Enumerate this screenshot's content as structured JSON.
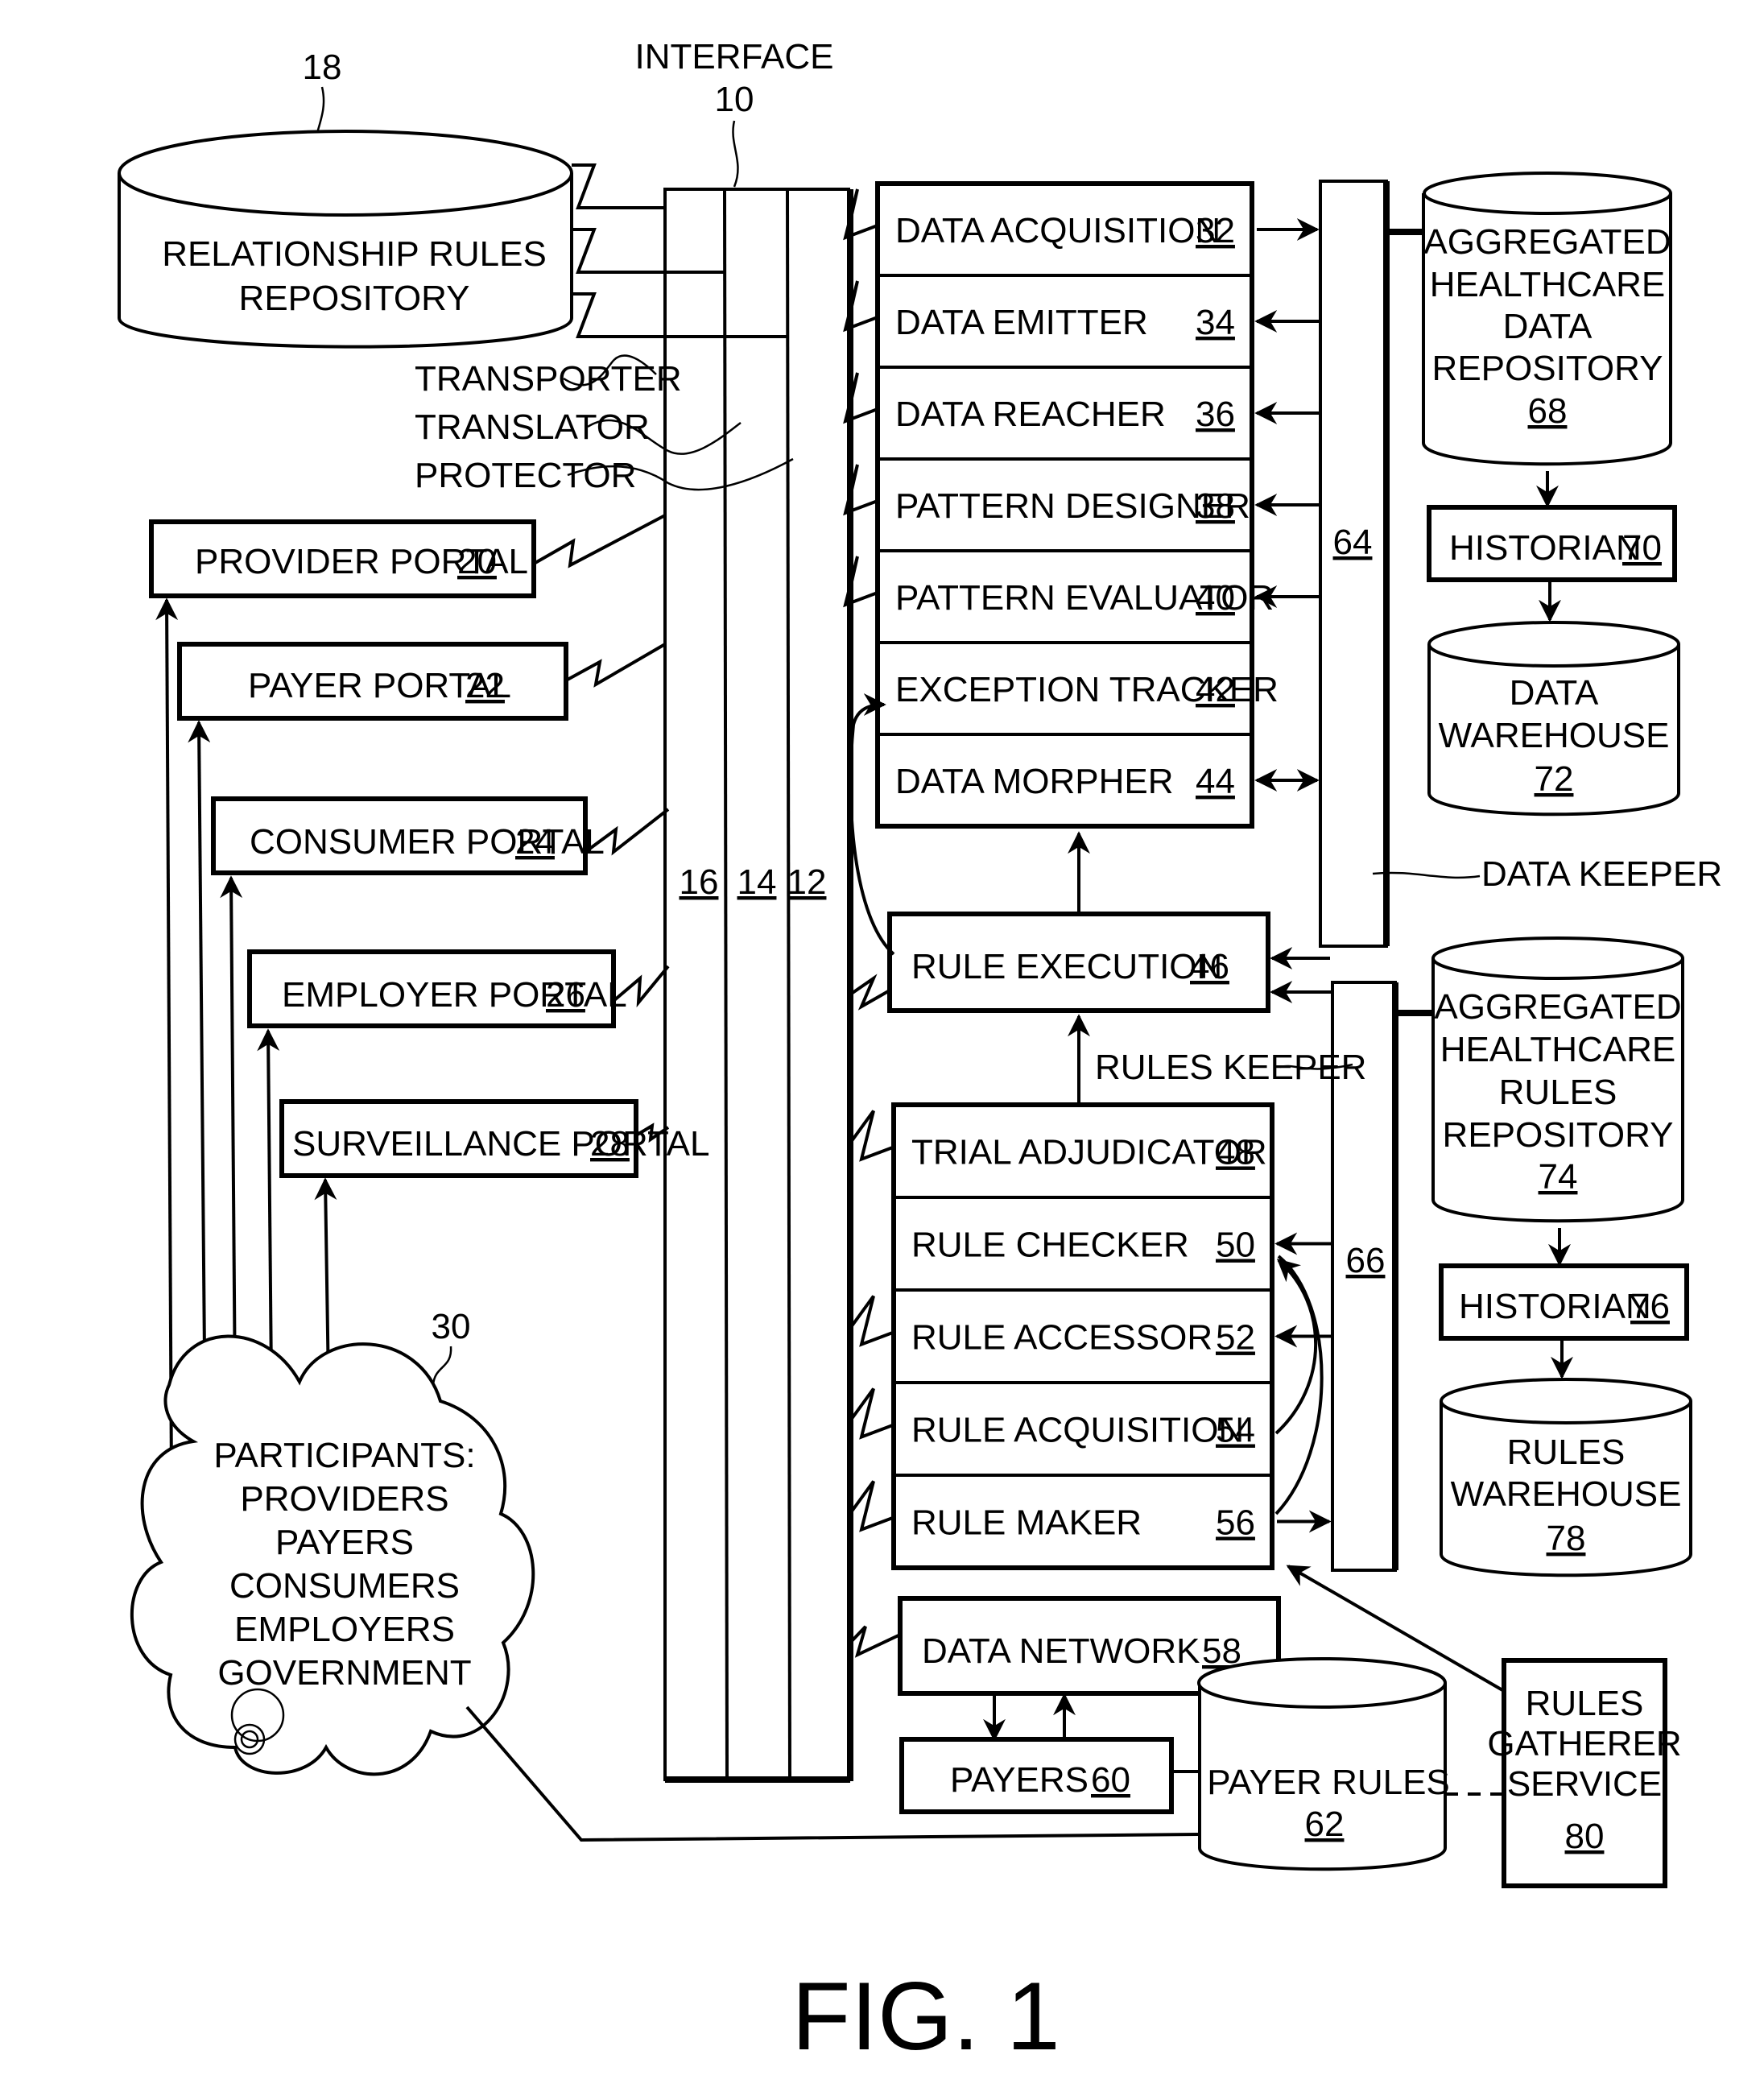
{
  "figure": {
    "caption": "FIG. 1",
    "interface": {
      "title": "INTERFACE",
      "ref": "10",
      "layers": [
        {
          "name": "TRANSPORTER",
          "ref": "16"
        },
        {
          "name": "TRANSLATOR",
          "ref": "14"
        },
        {
          "name": "PROTECTOR",
          "ref": "12"
        }
      ]
    },
    "relationship_repository": {
      "line1": "RELATIONSHIP RULES",
      "line2": "REPOSITORY",
      "ref": "18"
    },
    "portals": [
      {
        "label": "PROVIDER PORTAL",
        "ref": "20"
      },
      {
        "label": "PAYER PORTAL",
        "ref": "22"
      },
      {
        "label": "CONSUMER PORTAL",
        "ref": "24"
      },
      {
        "label": "EMPLOYER PORTAL",
        "ref": "26"
      },
      {
        "label": "SURVEILLANCE PORTAL",
        "ref": "28"
      }
    ],
    "participants": {
      "ref": "30",
      "lines": [
        "PARTICIPANTS:",
        "PROVIDERS",
        "PAYERS",
        "CONSUMERS",
        "EMPLOYERS",
        "GOVERNMENT"
      ]
    },
    "data_modules": [
      {
        "label": "DATA ACQUISITION",
        "ref": "32"
      },
      {
        "label": "DATA EMITTER",
        "ref": "34"
      },
      {
        "label": "DATA REACHER",
        "ref": "36"
      },
      {
        "label": "PATTERN DESIGNER",
        "ref": "38"
      },
      {
        "label": "PATTERN EVALUATOR",
        "ref": "40"
      },
      {
        "label": "EXCEPTION TRACKER",
        "ref": "42"
      },
      {
        "label": "DATA MORPHER",
        "ref": "44"
      }
    ],
    "rule_execution": {
      "label": "RULE EXECUTION",
      "ref": "46"
    },
    "rule_modules": [
      {
        "label": "TRIAL ADJUDICATOR",
        "ref": "48"
      },
      {
        "label": "RULE CHECKER",
        "ref": "50"
      },
      {
        "label": "RULE ACCESSOR",
        "ref": "52"
      },
      {
        "label": "RULE ACQUISITION",
        "ref": "54"
      },
      {
        "label": "RULE MAKER",
        "ref": "56"
      }
    ],
    "data_network": {
      "label": "DATA NETWORK",
      "ref": "58"
    },
    "payers": {
      "label": "PAYERS",
      "ref": "60"
    },
    "payer_rules": {
      "label": "PAYER RULES",
      "ref": "62"
    },
    "data_keeper": {
      "label": "DATA KEEPER",
      "ref": "64"
    },
    "rules_keeper": {
      "label": "RULES KEEPER",
      "ref": "66"
    },
    "data_repository": {
      "lines": [
        "AGGREGATED",
        "HEALTHCARE",
        "DATA",
        "REPOSITORY"
      ],
      "ref": "68"
    },
    "historian_data": {
      "label": "HISTORIAN",
      "ref": "70"
    },
    "data_warehouse": {
      "lines": [
        "DATA",
        "WAREHOUSE"
      ],
      "ref": "72"
    },
    "rules_repository": {
      "lines": [
        "AGGREGATED",
        "HEALTHCARE",
        "RULES",
        "REPOSITORY"
      ],
      "ref": "74"
    },
    "historian_rules": {
      "label": "HISTORIAN",
      "ref": "76"
    },
    "rules_warehouse": {
      "lines": [
        "RULES",
        "WAREHOUSE"
      ],
      "ref": "78"
    },
    "rules_gatherer": {
      "lines": [
        "RULES",
        "GATHERER",
        "SERVICE"
      ],
      "ref": "80"
    }
  }
}
